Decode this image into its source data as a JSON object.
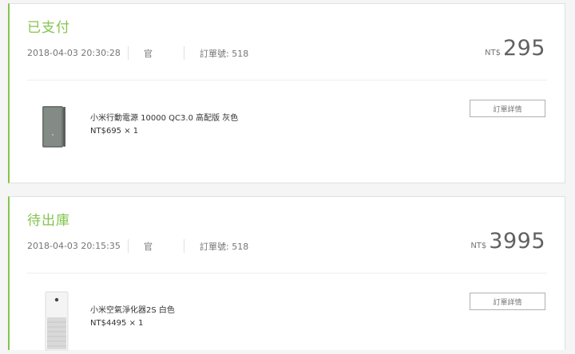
{
  "orders": [
    {
      "status": "已支付",
      "date": "2018-04-03 20:30:28",
      "purchaser": "官",
      "order_no_label": "訂單號: 518",
      "currency": "NT$",
      "total": "295",
      "item": {
        "name": "小米行動電源 10000 QC3.0 高配版 灰色",
        "price_qty": "NT$695 × 1",
        "image_icon": "power-bank-image"
      },
      "detail_button": "訂單詳情"
    },
    {
      "status": "待出庫",
      "date": "2018-04-03 20:15:35",
      "purchaser": "官",
      "order_no_label": "訂單號: 518",
      "currency": "NT$",
      "total": "3995",
      "item": {
        "name": "小米空氣淨化器2S 白色",
        "price_qty": "NT$4495 × 1",
        "image_icon": "air-purifier-image"
      },
      "detail_button": "訂單詳情"
    }
  ],
  "colors": {
    "status_green": "#83c44e",
    "text_muted": "#757575"
  }
}
